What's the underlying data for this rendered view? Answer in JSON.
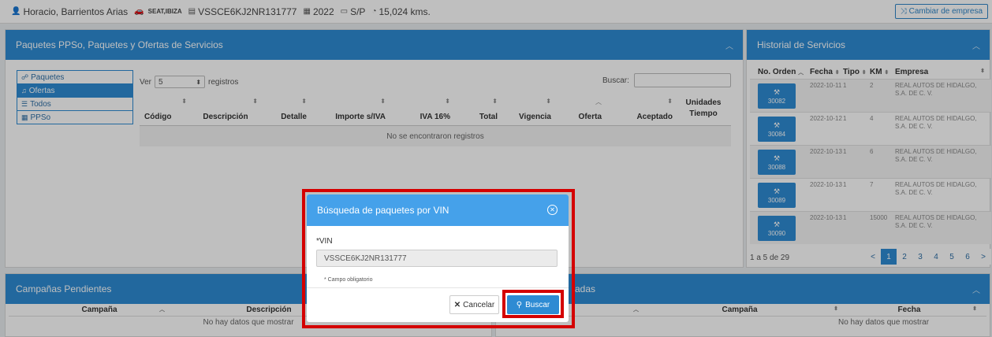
{
  "topbar": {
    "customer": "Horacio, Barrientos Arias",
    "brand": "SEAT,IBIZA",
    "vin": "VSSCE6KJ2NR131777",
    "year": "2022",
    "plate": "S/P",
    "mileage": "15,024 kms.",
    "change_company": "Cambiar de empresa"
  },
  "packages_panel": {
    "title": "Paquetes PPSo, Paquetes y Ofertas de Servicios",
    "nav": [
      {
        "icon": "☍",
        "label": "Paquetes"
      },
      {
        "icon": "♫",
        "label": "Ofertas"
      },
      {
        "icon": "☰",
        "label": "Todos"
      },
      {
        "icon": "▦",
        "label": "PPSo"
      }
    ],
    "ver_label": "Ver",
    "ver_value": "5",
    "registros_label": "registros",
    "search_label": "Buscar:",
    "columns": [
      "Código",
      "Descripción",
      "Detalle",
      "Importe s/IVA",
      "IVA 16%",
      "Total",
      "Vigencia",
      "Oferta",
      "Aceptado",
      "Unidades Tiempo"
    ],
    "empty": "No se encontraron registros"
  },
  "history_panel": {
    "title": "Historial de Servicios",
    "columns": [
      "No. Orden",
      "Fecha",
      "Tipo",
      "KM",
      "Empresa"
    ],
    "rows": [
      {
        "order": "30082",
        "date": "2022-10-11",
        "type": "1",
        "km": "2",
        "company": "REAL AUTOS DE HIDALGO, S.A. DE C. V."
      },
      {
        "order": "30084",
        "date": "2022-10-12",
        "type": "1",
        "km": "4",
        "company": "REAL AUTOS DE HIDALGO, S.A. DE C. V."
      },
      {
        "order": "30088",
        "date": "2022-10-13",
        "type": "1",
        "km": "6",
        "company": "REAL AUTOS DE HIDALGO, S.A. DE C. V."
      },
      {
        "order": "30089",
        "date": "2022-10-13",
        "type": "1",
        "km": "7",
        "company": "REAL AUTOS DE HIDALGO, S.A. DE C. V."
      },
      {
        "order": "30090",
        "date": "2022-10-13",
        "type": "1",
        "km": "15000",
        "company": "REAL AUTOS DE HIDALGO, S.A. DE C. V."
      }
    ],
    "pager_info": "1 a 5 de 29",
    "pages": [
      "<",
      "1",
      "2",
      "3",
      "4",
      "5",
      "6",
      ">"
    ]
  },
  "campaigns_panel": {
    "title": "Campañas Pendientes",
    "col1": "Campaña",
    "col2": "Descripción",
    "empty": "No hay datos que mostrar"
  },
  "applied_panel": {
    "title": "adas",
    "col1": "Campaña",
    "col2": "Fecha",
    "empty": "No hay datos que mostrar"
  },
  "modal": {
    "title": "Búsqueda de paquetes por VIN",
    "vin_label": "*VIN",
    "vin_value": "VSSCE6KJ2NR131777",
    "required_note": "* Campo obligatorio",
    "cancel": "Cancelar",
    "search": "Buscar"
  },
  "colors": {
    "primary": "#2e8bd3",
    "modal_header": "#45a1ea",
    "highlight": "#d40000"
  }
}
